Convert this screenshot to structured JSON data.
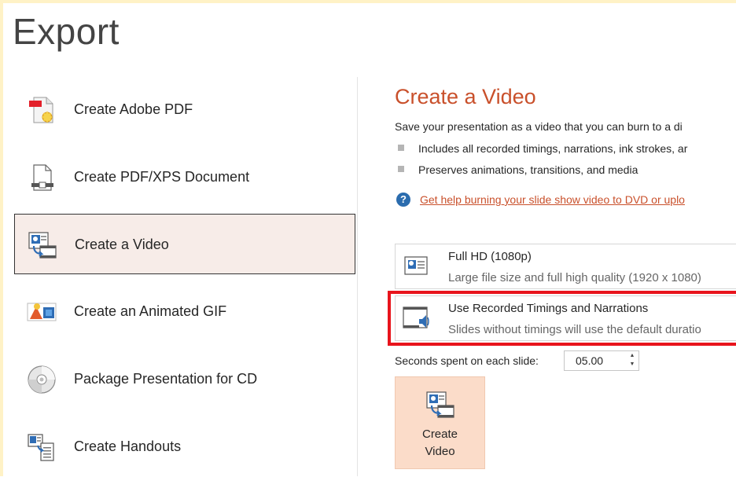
{
  "page": {
    "title": "Export"
  },
  "nav": {
    "items": [
      {
        "label": "Create Adobe PDF",
        "icon": "adobe-pdf-icon"
      },
      {
        "label": "Create PDF/XPS Document",
        "icon": "pdf-xps-document-icon"
      },
      {
        "label": "Create a Video",
        "icon": "video-icon",
        "selected": true
      },
      {
        "label": "Create an Animated GIF",
        "icon": "animated-gif-icon"
      },
      {
        "label": "Package Presentation for CD",
        "icon": "cd-icon"
      },
      {
        "label": "Create Handouts",
        "icon": "handouts-icon"
      }
    ]
  },
  "content": {
    "title": "Create a Video",
    "description": "Save your presentation as a video that you can burn to a di",
    "bullets": [
      "Includes all recorded timings, narrations, ink strokes, ar",
      "Preserves animations, transitions, and media"
    ],
    "help_link": "Get help burning your slide show video to DVD or uplo",
    "quality_dropdown": {
      "title": "Full HD (1080p)",
      "subtitle": "Large file size and full high quality (1920 x 1080)"
    },
    "timings_dropdown": {
      "title": "Use Recorded Timings and Narrations",
      "subtitle": "Slides without timings will use the default duratio"
    },
    "seconds_label": "Seconds spent on each slide:",
    "seconds_value": "05.00",
    "create_button_label": "Create\nVideo"
  },
  "colors": {
    "accent": "#c9502b",
    "selected_bg": "#f7ece8",
    "button_bg": "#fbdcc9",
    "highlight_border": "#e8141c"
  }
}
